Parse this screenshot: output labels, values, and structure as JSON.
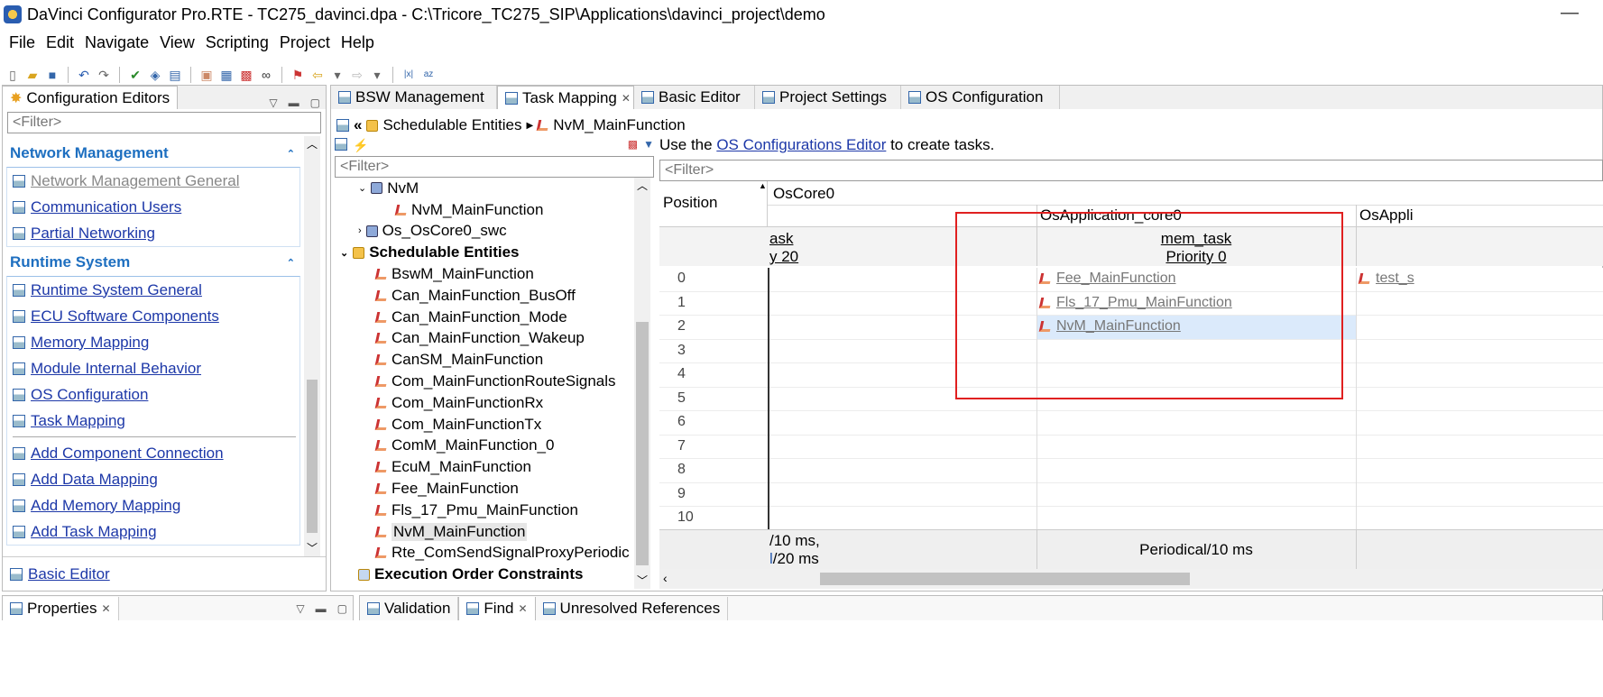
{
  "window": {
    "title": "DaVinci Configurator Pro.RTE - TC275_davinci.dpa - C:\\Tricore_TC275_SIP\\Applications\\davinci_project\\demo",
    "minimize": "—"
  },
  "menu": [
    "File",
    "Edit",
    "Navigate",
    "View",
    "Scripting",
    "Project",
    "Help"
  ],
  "left_panel": {
    "tab": "Configuration Editors",
    "filter_placeholder": "<Filter>",
    "sections": [
      {
        "title": "Network Management",
        "items": [
          "Network Management General",
          "Communication Users",
          "Partial Networking"
        ]
      },
      {
        "title": "Runtime System",
        "items": [
          "Runtime System General",
          "ECU Software Components",
          "Memory Mapping",
          "Module Internal Behavior",
          "OS Configuration",
          "Task Mapping"
        ],
        "actions": [
          "Add Component Connection",
          "Add Data Mapping",
          "Add Memory Mapping",
          "Add Task Mapping"
        ]
      }
    ],
    "footer_link": "Basic Editor"
  },
  "editor_tabs": [
    "BSW Management",
    "Task Mapping",
    "Basic Editor",
    "Project Settings",
    "OS Configuration"
  ],
  "breadcrumb": {
    "root": "Schedulable Entities",
    "leaf": "NvM_MainFunction"
  },
  "tree": {
    "filter_placeholder": "<Filter>",
    "nvm": "NvM",
    "nvm_child": "NvM_MainFunction",
    "os_swc": "Os_OsCore0_swc",
    "schedulable": "Schedulable Entities",
    "entities": [
      "BswM_MainFunction",
      "Can_MainFunction_BusOff",
      "Can_MainFunction_Mode",
      "Can_MainFunction_Wakeup",
      "CanSM_MainFunction",
      "Com_MainFunctionRouteSignals",
      "Com_MainFunctionRx",
      "Com_MainFunctionTx",
      "ComM_MainFunction_0",
      "EcuM_MainFunction",
      "Fee_MainFunction",
      "Fls_17_Pmu_MainFunction",
      "NvM_MainFunction",
      "Rte_ComSendSignalProxyPeriodic"
    ],
    "constraints": "Execution Order Constraints"
  },
  "grid": {
    "hint_prefix": "Use the ",
    "hint_link": "OS Configurations Editor",
    "hint_suffix": " to create tasks.",
    "filter_placeholder": "<Filter>",
    "position_header": "Position",
    "core": "OsCore0",
    "app1": "OsApplication_core0",
    "app2": "OsAppli",
    "task_left_name": "ask",
    "task_left_prio": "y 20",
    "task_mid_name": "mem_task",
    "task_mid_prio": "Priority 0",
    "positions": [
      "0",
      "1",
      "2",
      "3",
      "4",
      "5",
      "6",
      "7",
      "8",
      "9",
      "10"
    ],
    "mid_entries": [
      "Fee_MainFunction",
      "Fls_17_Pmu_MainFunction",
      "NvM_MainFunction"
    ],
    "right_entry": "test_s",
    "footer_left_1": "/10 ms,",
    "footer_left_2": "/20 ms",
    "footer_mid": "Periodical/10 ms",
    "footer_left_2_mark": "l"
  },
  "bottom_tabs": {
    "properties": "Properties",
    "validation": "Validation",
    "find": "Find",
    "unresolved": "Unresolved References"
  },
  "colors": {
    "highlight_box": "#e02020",
    "section_title": "#1e6fc0",
    "link": "#1d38a8",
    "selected_row": "#dbeafb"
  }
}
